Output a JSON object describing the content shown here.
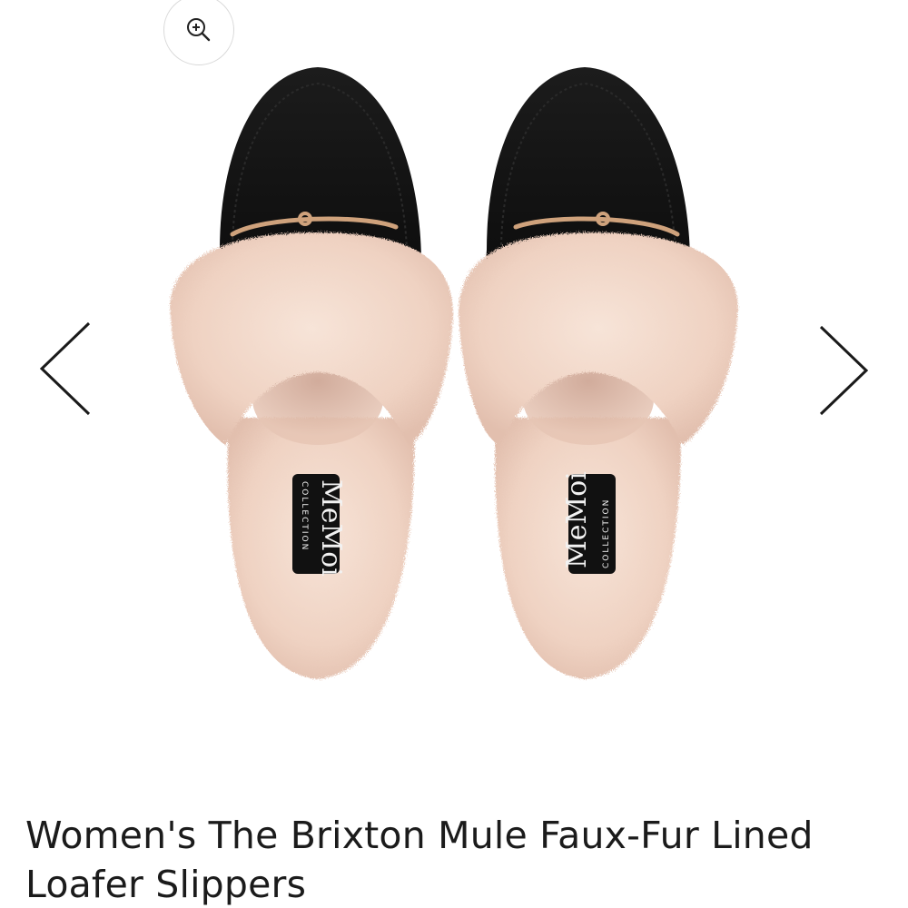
{
  "product": {
    "title": "Women's The Brixton Mule Faux-Fur Lined Loafer Slippers",
    "insole_brand_text": "MeMoi",
    "insole_sub_text": "COLLECTION",
    "image_alt": "Women's The Brixton Mule Faux-Fur Lined Loafer Slippers"
  },
  "gallery": {
    "zoom_icon": "zoom-in-icon",
    "prev_icon": "chevron-left-icon",
    "next_icon": "chevron-right-icon"
  },
  "colors": {
    "suede": "#141414",
    "fur": "#f1d7c8",
    "fur_shadow": "#d9b4a2",
    "buckle": "#cfa27c",
    "title_text": "#1b1b1b"
  }
}
